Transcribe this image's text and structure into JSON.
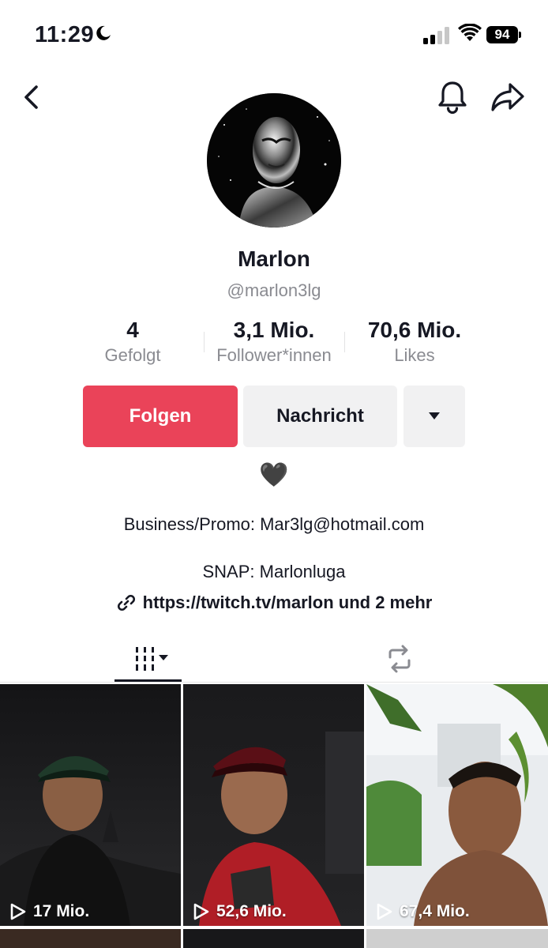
{
  "status_bar": {
    "time": "11:29",
    "battery": "94"
  },
  "profile": {
    "name": "Marlon",
    "handle": "@marlon3lg",
    "stats": [
      {
        "value": "4",
        "label": "Gefolgt"
      },
      {
        "value": "3,1 Mio.",
        "label": "Follower*innen"
      },
      {
        "value": "70,6 Mio.",
        "label": "Likes"
      }
    ]
  },
  "actions": {
    "follow_label": "Folgen",
    "message_label": "Nachricht"
  },
  "bio": {
    "emoji": "🖤",
    "line1": "Business/Promo: Mar3lg@hotmail.com",
    "line2": "SNAP: Marlonluga",
    "link": "https://twitch.tv/marlon und 2 mehr"
  },
  "videos": [
    {
      "views": "17 Mio."
    },
    {
      "views": "52,6 Mio."
    },
    {
      "views": "67,4 Mio."
    }
  ],
  "colors": {
    "accent": "#ea4359",
    "secondary_bg": "#f1f1f2",
    "muted_text": "#8a8b91"
  }
}
